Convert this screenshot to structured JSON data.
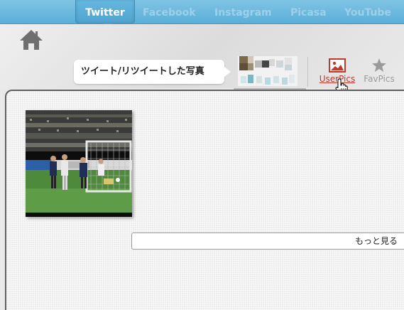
{
  "tabs": [
    {
      "label": "Twitter",
      "active": true
    },
    {
      "label": "Facebook",
      "active": false
    },
    {
      "label": "Instagram",
      "active": false
    },
    {
      "label": "Picasa",
      "active": false
    },
    {
      "label": "YouTube",
      "active": false
    }
  ],
  "header": {
    "home_icon": "home-icon",
    "bubble_text": "ツイート/リツイートした写真",
    "avatar": "user-avatar-pixelated",
    "buttons": [
      {
        "label": "UserPics",
        "icon": "image-icon",
        "active": true,
        "color": "#c0392b"
      },
      {
        "label": "FavPics",
        "icon": "star-icon",
        "active": false,
        "color": "#9a9a9a"
      }
    ]
  },
  "main": {
    "photos": [
      {
        "subject": "soccer-match-photo"
      }
    ],
    "more_button": "もっと見る"
  },
  "colors": {
    "accent": "#5aaed8",
    "active_icon": "#c0392b"
  }
}
